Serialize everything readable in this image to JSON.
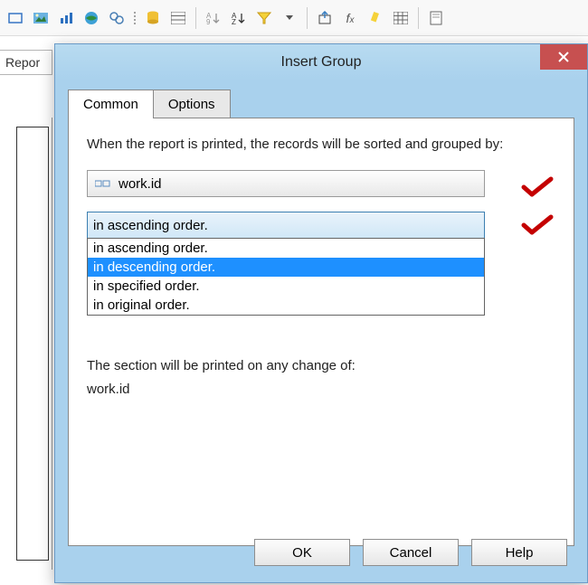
{
  "toolbar": {
    "icons": [
      "rect-icon",
      "image-icon",
      "chart-icon",
      "globe-icon",
      "circles-icon",
      "db-icon",
      "grid-icon",
      "sort-nat-icon",
      "sort-az-icon",
      "filter-icon",
      "dropdown-icon",
      "export-icon",
      "fx-icon",
      "highlight-icon",
      "table-icon",
      "page-icon"
    ]
  },
  "leftTabText": "Repor",
  "dialog": {
    "title": "Insert Group",
    "tabs": [
      {
        "label": "Common",
        "active": true
      },
      {
        "label": "Options",
        "active": false
      }
    ],
    "introText": "When the report is printed, the records will be sorted and grouped by:",
    "fieldValue": "work.id",
    "sortSelected": "in ascending order.",
    "sortOptions": [
      {
        "label": "in ascending order.",
        "highlighted": false
      },
      {
        "label": "in descending order.",
        "highlighted": true
      },
      {
        "label": "in specified order.",
        "highlighted": false
      },
      {
        "label": "in original order.",
        "highlighted": false
      }
    ],
    "sectionLine1": "The section will be printed on any change of:",
    "sectionLine2": "work.id",
    "buttons": {
      "ok": "OK",
      "cancel": "Cancel",
      "help": "Help"
    }
  },
  "annotationChecks": [
    "✓",
    "✓"
  ]
}
